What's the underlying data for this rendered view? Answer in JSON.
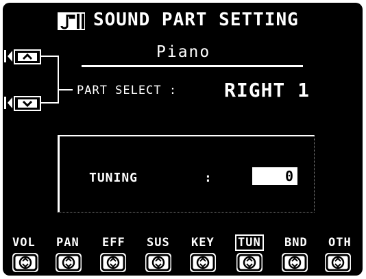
{
  "title": "SOUND PART SETTING",
  "voice_name": "Piano",
  "part_select": {
    "label": "PART SELECT :",
    "value": "RIGHT 1"
  },
  "tuning": {
    "label": "TUNING",
    "colon": ":",
    "value": "0"
  },
  "tabs": [
    {
      "label": "VOL",
      "selected": false
    },
    {
      "label": "PAN",
      "selected": false
    },
    {
      "label": "EFF",
      "selected": false
    },
    {
      "label": "SUS",
      "selected": false
    },
    {
      "label": "KEY",
      "selected": false
    },
    {
      "label": "TUN",
      "selected": true
    },
    {
      "label": "BND",
      "selected": false
    },
    {
      "label": "OTH",
      "selected": false
    }
  ],
  "icons": {
    "title": "music-part-icon",
    "up": "up-arrow-icon",
    "down": "down-arrow-icon",
    "knob": "up-down-knob-icon"
  },
  "colors": {
    "background": "#000000",
    "foreground": "#ffffff"
  }
}
